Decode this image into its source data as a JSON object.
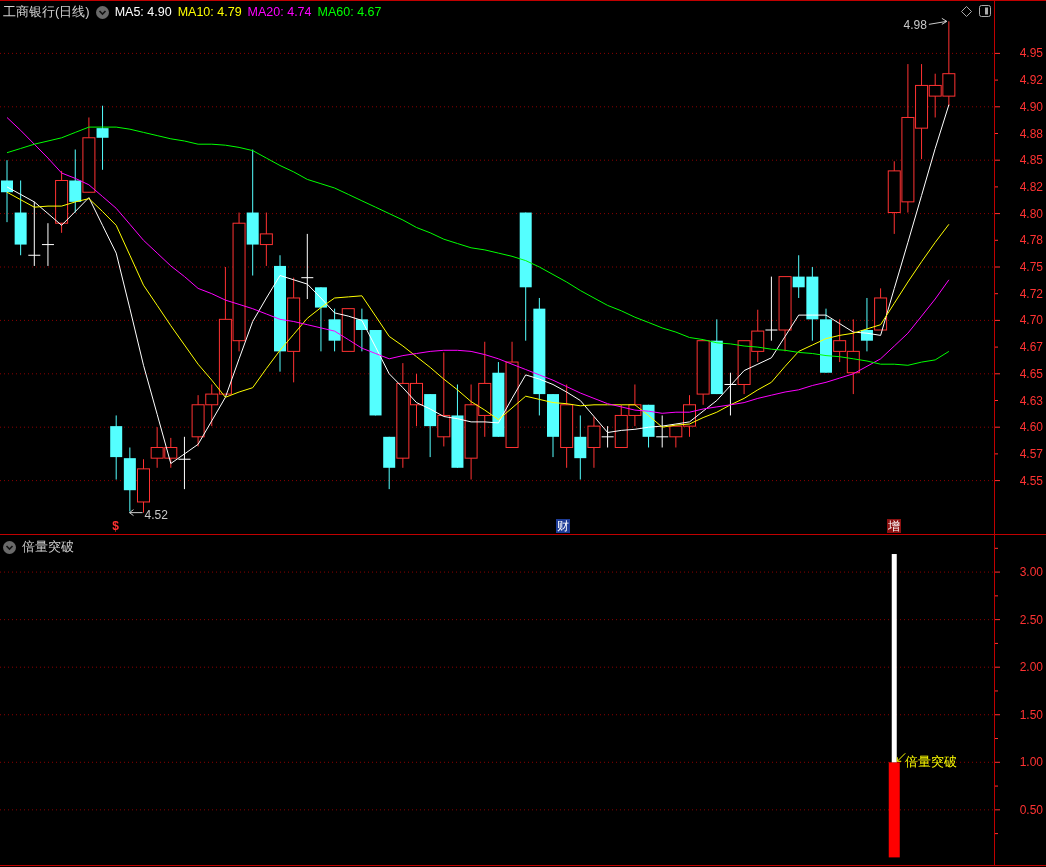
{
  "price_panel": {
    "title": "工商银行(日线)",
    "legend": [
      {
        "label": "MA5: 4.90",
        "color": "#ffffff"
      },
      {
        "label": "MA10: 4.79",
        "color": "#ffff00"
      },
      {
        "label": "MA20: 4.74",
        "color": "#ff00ff"
      },
      {
        "label": "MA60: 4.67",
        "color": "#00ff00"
      }
    ],
    "markers": [
      {
        "text": "$",
        "kind": "plain",
        "color": "#ff3232"
      },
      {
        "text": "财",
        "kind": "boxed",
        "color": "#1e3c96"
      },
      {
        "text": "增",
        "kind": "boxed",
        "color": "#8b1010"
      }
    ],
    "chart_data": {
      "type": "candlestick",
      "grid": true,
      "ylim": [
        4.5,
        5.0
      ],
      "categories": [
        null,
        null,
        null,
        null,
        null,
        null,
        null,
        null,
        null,
        null,
        null,
        null,
        null,
        null,
        null,
        null,
        null,
        null,
        null,
        null,
        null,
        null,
        null,
        null,
        null,
        null,
        null,
        null,
        null,
        null,
        null,
        null,
        null,
        null,
        null,
        null,
        null,
        null,
        null,
        null,
        null,
        null,
        null,
        null,
        null,
        null,
        null,
        null,
        null,
        null,
        null,
        null,
        null,
        null,
        null,
        null,
        null,
        null,
        null,
        null,
        null,
        null,
        null,
        null,
        null,
        null,
        null,
        null,
        null,
        null
      ],
      "yticks": [
        {
          "value": 4.95,
          "label": "4.95"
        },
        {
          "value": 4.925,
          "label": "4.92"
        },
        {
          "value": 4.9,
          "label": "4.90"
        },
        {
          "value": 4.875,
          "label": "4.88"
        },
        {
          "value": 4.85,
          "label": "4.85"
        },
        {
          "value": 4.825,
          "label": "4.82"
        },
        {
          "value": 4.8,
          "label": "4.80"
        },
        {
          "value": 4.775,
          "label": "4.78"
        },
        {
          "value": 4.75,
          "label": "4.75"
        },
        {
          "value": 4.725,
          "label": "4.72"
        },
        {
          "value": 4.7,
          "label": "4.70"
        },
        {
          "value": 4.675,
          "label": "4.67"
        },
        {
          "value": 4.65,
          "label": "4.65"
        },
        {
          "value": 4.625,
          "label": "4.63"
        },
        {
          "value": 4.6,
          "label": "4.60"
        },
        {
          "value": 4.575,
          "label": "4.57"
        },
        {
          "value": 4.55,
          "label": "4.55"
        }
      ],
      "ohlc": [
        [
          4.831,
          4.85,
          4.792,
          4.82
        ],
        [
          4.801,
          4.831,
          4.761,
          4.771
        ],
        [
          4.761,
          4.811,
          4.751,
          4.761
        ],
        [
          4.771,
          4.791,
          4.751,
          4.771
        ],
        [
          4.791,
          4.84,
          4.782,
          4.831
        ],
        [
          4.831,
          4.86,
          4.801,
          4.811
        ],
        [
          4.82,
          4.89,
          4.82,
          4.871
        ],
        [
          4.88,
          4.901,
          4.841,
          4.871
        ],
        [
          4.601,
          4.611,
          4.551,
          4.572
        ],
        [
          4.571,
          4.581,
          4.521,
          4.541
        ],
        [
          4.53,
          4.57,
          4.52,
          4.561
        ],
        [
          4.571,
          4.6,
          4.562,
          4.581
        ],
        [
          4.571,
          4.59,
          4.562,
          4.581
        ],
        [
          4.57,
          4.591,
          4.542,
          4.57
        ],
        [
          4.591,
          4.63,
          4.582,
          4.621
        ],
        [
          4.621,
          4.64,
          4.601,
          4.631
        ],
        [
          4.631,
          4.75,
          4.631,
          4.701
        ],
        [
          4.681,
          4.801,
          4.671,
          4.791
        ],
        [
          4.801,
          4.86,
          4.742,
          4.771
        ],
        [
          4.771,
          4.801,
          4.751,
          4.781
        ],
        [
          4.751,
          4.761,
          4.652,
          4.671
        ],
        [
          4.671,
          4.74,
          4.642,
          4.721
        ],
        [
          4.74,
          4.781,
          4.72,
          4.74
        ],
        [
          4.731,
          4.731,
          4.671,
          4.712
        ],
        [
          4.701,
          4.711,
          4.671,
          4.681
        ],
        [
          4.671,
          4.711,
          4.671,
          4.711
        ],
        [
          4.701,
          4.711,
          4.671,
          4.691
        ],
        [
          4.691,
          4.691,
          4.611,
          4.611
        ],
        [
          4.591,
          4.591,
          4.542,
          4.562
        ],
        [
          4.571,
          4.66,
          4.562,
          4.641
        ],
        [
          4.621,
          4.65,
          4.601,
          4.641
        ],
        [
          4.631,
          4.631,
          4.572,
          4.601
        ],
        [
          4.591,
          4.67,
          4.582,
          4.611
        ],
        [
          4.611,
          4.64,
          4.562,
          4.562
        ],
        [
          4.571,
          4.64,
          4.551,
          4.621
        ],
        [
          4.611,
          4.68,
          4.591,
          4.641
        ],
        [
          4.651,
          4.661,
          4.591,
          4.591
        ],
        [
          4.581,
          4.68,
          4.581,
          4.661
        ],
        [
          4.801,
          4.801,
          4.681,
          4.731
        ],
        [
          4.711,
          4.721,
          4.611,
          4.631
        ],
        [
          4.631,
          4.631,
          4.572,
          4.591
        ],
        [
          4.581,
          4.64,
          4.562,
          4.621
        ],
        [
          4.591,
          4.611,
          4.551,
          4.571
        ],
        [
          4.581,
          4.61,
          4.562,
          4.601
        ],
        [
          4.591,
          4.601,
          4.581,
          4.591
        ],
        [
          4.581,
          4.621,
          4.581,
          4.611
        ],
        [
          4.611,
          4.64,
          4.601,
          4.621
        ],
        [
          4.621,
          4.621,
          4.581,
          4.591
        ],
        [
          4.591,
          4.611,
          4.581,
          4.591
        ],
        [
          4.591,
          4.601,
          4.581,
          4.601
        ],
        [
          4.601,
          4.63,
          4.591,
          4.621
        ],
        [
          4.631,
          4.681,
          4.621,
          4.681
        ],
        [
          4.681,
          4.701,
          4.631,
          4.631
        ],
        [
          4.64,
          4.651,
          4.611,
          4.64
        ],
        [
          4.64,
          4.681,
          4.631,
          4.681
        ],
        [
          4.671,
          4.71,
          4.661,
          4.69
        ],
        [
          4.691,
          4.741,
          4.681,
          4.691
        ],
        [
          4.691,
          4.741,
          4.671,
          4.741
        ],
        [
          4.741,
          4.761,
          4.721,
          4.731
        ],
        [
          4.741,
          4.75,
          4.681,
          4.701
        ],
        [
          4.701,
          4.711,
          4.651,
          4.651
        ],
        [
          4.671,
          4.701,
          4.661,
          4.681
        ],
        [
          4.651,
          4.701,
          4.631,
          4.671
        ],
        [
          4.691,
          4.721,
          4.671,
          4.681
        ],
        [
          4.691,
          4.73,
          4.691,
          4.721
        ],
        [
          4.801,
          4.849,
          4.781,
          4.84
        ],
        [
          4.811,
          4.94,
          4.801,
          4.89
        ],
        [
          4.88,
          4.94,
          4.851,
          4.92
        ],
        [
          4.91,
          4.931,
          4.89,
          4.92
        ],
        [
          4.91,
          4.98,
          4.901,
          4.931
        ]
      ],
      "series": [
        {
          "type": "line",
          "color": "#ffffff",
          "values": [
            4.825,
            4.818,
            4.811,
            4.8,
            4.789,
            4.802,
            4.815,
            4.789,
            4.763,
            4.711,
            4.658,
            4.612,
            4.566,
            4.575,
            4.584,
            4.606,
            4.628,
            4.664,
            4.699,
            4.721,
            4.742,
            4.738,
            4.734,
            4.721,
            4.707,
            4.704,
            4.7,
            4.675,
            4.65,
            4.637,
            4.623,
            4.617,
            4.61,
            4.608,
            4.605,
            4.605,
            4.604,
            4.627,
            4.649,
            4.645,
            4.64,
            4.633,
            4.625,
            4.61,
            4.595,
            4.597,
            4.598,
            4.6,
            4.601,
            4.603,
            4.605,
            4.615,
            4.625,
            4.639,
            4.653,
            4.659,
            4.665,
            4.685,
            4.705,
            4.705,
            4.705,
            4.697,
            4.689,
            4.688,
            4.686,
            4.73,
            4.773,
            4.817,
            4.861,
            4.902
          ]
        },
        {
          "type": "line",
          "color": "#ffff00",
          "values": [
            4.82,
            4.813,
            4.806,
            4.807,
            4.807,
            4.811,
            4.814,
            4.802,
            4.789,
            4.761,
            4.733,
            4.714,
            4.695,
            4.677,
            4.659,
            4.644,
            4.628,
            4.633,
            4.637,
            4.655,
            4.672,
            4.687,
            4.702,
            4.712,
            4.721,
            4.722,
            4.723,
            4.704,
            4.685,
            4.676,
            4.666,
            4.656,
            4.645,
            4.635,
            4.624,
            4.616,
            4.607,
            4.618,
            4.629,
            4.626,
            4.623,
            4.622,
            4.62,
            4.621,
            4.621,
            4.621,
            4.621,
            4.611,
            4.6,
            4.602,
            4.603,
            4.609,
            4.614,
            4.621,
            4.627,
            4.635,
            4.642,
            4.657,
            4.671,
            4.677,
            4.683,
            4.686,
            4.688,
            4.692,
            4.696,
            4.716,
            4.736,
            4.755,
            4.773,
            4.79
          ]
        },
        {
          "type": "line",
          "color": "#ff00ff",
          "values": [
            4.89,
            4.878,
            4.865,
            4.852,
            4.838,
            4.833,
            4.827,
            4.816,
            4.805,
            4.79,
            4.775,
            4.763,
            4.751,
            4.741,
            4.73,
            4.725,
            4.719,
            4.715,
            4.711,
            4.706,
            4.701,
            4.699,
            4.696,
            4.693,
            4.69,
            4.682,
            4.674,
            4.669,
            4.664,
            4.667,
            4.669,
            4.671,
            4.672,
            4.672,
            4.671,
            4.668,
            4.664,
            4.659,
            4.654,
            4.649,
            4.644,
            4.638,
            4.632,
            4.627,
            4.622,
            4.619,
            4.616,
            4.615,
            4.613,
            4.614,
            4.614,
            4.617,
            4.619,
            4.621,
            4.623,
            4.627,
            4.63,
            4.633,
            4.635,
            4.639,
            4.642,
            4.646,
            4.65,
            4.657,
            4.664,
            4.676,
            4.688,
            4.704,
            4.72,
            4.738
          ]
        },
        {
          "type": "line",
          "color": "#00ff00",
          "values": [
            4.857,
            4.861,
            4.865,
            4.868,
            4.871,
            4.876,
            4.881,
            4.881,
            4.881,
            4.879,
            4.876,
            4.873,
            4.87,
            4.868,
            4.865,
            4.865,
            4.864,
            4.862,
            4.859,
            4.852,
            4.845,
            4.839,
            4.832,
            4.828,
            4.824,
            4.818,
            4.812,
            4.806,
            4.8,
            4.794,
            4.787,
            4.782,
            4.776,
            4.772,
            4.768,
            4.766,
            4.763,
            4.76,
            4.756,
            4.75,
            4.743,
            4.736,
            4.728,
            4.721,
            4.714,
            4.709,
            4.703,
            4.698,
            4.693,
            4.689,
            4.684,
            4.682,
            4.679,
            4.678,
            4.676,
            4.675,
            4.673,
            4.672,
            4.67,
            4.669,
            4.667,
            4.666,
            4.664,
            4.662,
            4.659,
            4.659,
            4.658,
            4.661,
            4.663,
            4.671
          ]
        }
      ],
      "annotations": [
        {
          "text": "4.98"
        },
        {
          "text": "4.52"
        }
      ]
    }
  },
  "indicator_panel": {
    "title": "倍量突破",
    "chart_data": {
      "type": "bar",
      "stacked": true,
      "grid": true,
      "ylim": [
        -0.08,
        3.39
      ],
      "categories": [
        null
      ],
      "yticks": [
        {
          "value": 3.0,
          "label": "3.00"
        },
        {
          "value": 2.5,
          "label": "2.50"
        },
        {
          "value": 2.0,
          "label": "2.00"
        },
        {
          "value": 1.5,
          "label": "1.50"
        },
        {
          "value": 1.0,
          "label": "1.00"
        },
        {
          "value": 0.5,
          "label": "0.50"
        }
      ],
      "series": [
        {
          "color": "#ff0000",
          "values": [
            1.0
          ]
        },
        {
          "color": "#ffffff",
          "values": [
            2.19
          ]
        }
      ],
      "annotations": [
        {
          "text": "倍量突破"
        }
      ]
    }
  }
}
